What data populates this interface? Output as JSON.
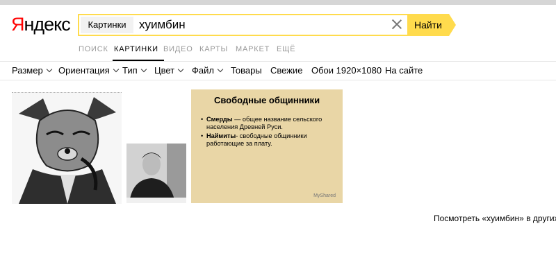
{
  "logo": {
    "first": "Я",
    "rest": "ндекс"
  },
  "search": {
    "scope": "Картинки",
    "query": "хуимбин",
    "button": "Найти"
  },
  "tabs": [
    {
      "label": "Поиск",
      "active": false
    },
    {
      "label": "Картинки",
      "active": true
    },
    {
      "label": "Видео",
      "active": false
    },
    {
      "label": "Карты",
      "active": false
    },
    {
      "label": "Маркет",
      "active": false
    },
    {
      "label": "Ещё",
      "active": false
    }
  ],
  "filters": [
    {
      "label": "Размер",
      "dropdown": true
    },
    {
      "label": "Ориентация",
      "dropdown": true
    },
    {
      "label": "Тип",
      "dropdown": true
    },
    {
      "label": "Цвет",
      "dropdown": true
    },
    {
      "label": "Файл",
      "dropdown": true
    },
    {
      "label": "Товары",
      "dropdown": false
    },
    {
      "label": "Свежие",
      "dropdown": false
    },
    {
      "label": "Обои 1920×1080",
      "dropdown": false
    },
    {
      "label": "На сайте",
      "dropdown": false
    }
  ],
  "results": {
    "slide": {
      "title": "Свободные общинники",
      "items": [
        {
          "term": "Смерды",
          "text": " — общее название сельского населения Древней Руси."
        },
        {
          "term": "Наймиты",
          "text": "- свободные общинники работающие за плату."
        }
      ],
      "watermark": "MyShared"
    }
  },
  "footer": {
    "more": "Посмотреть «хуимбин» в других п"
  },
  "colors": {
    "accent": "#ffdb4d",
    "logo_red": "#ff0000"
  }
}
